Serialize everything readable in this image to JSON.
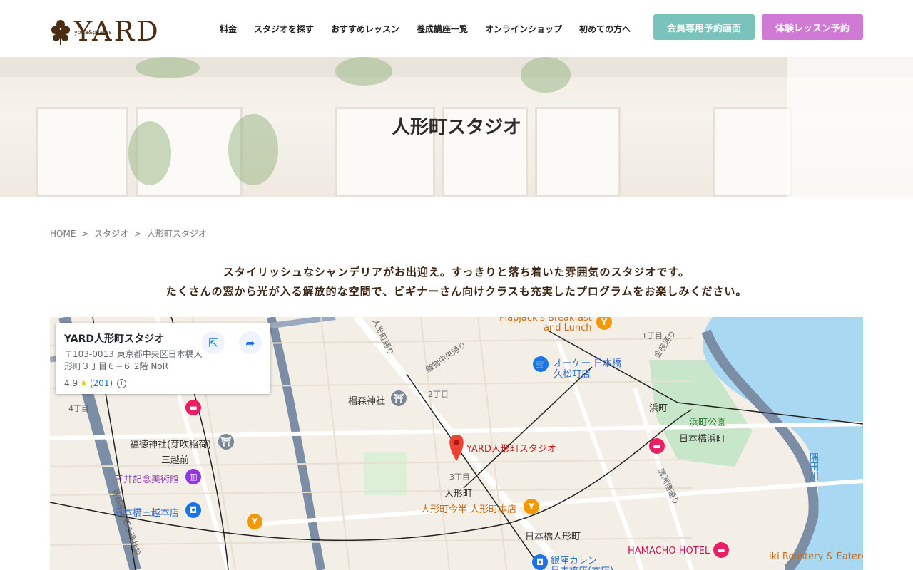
{
  "header": {
    "logo_text": "YARD",
    "logo_sub": "yoga&pilates",
    "nav": [
      "料金",
      "スタジオを探す",
      "おすすめレッスン",
      "養成講座一覧",
      "オンラインショップ",
      "初めての方へ"
    ],
    "member_button": "会員専用予約画面",
    "trial_button": "体験レッスン予約",
    "colors": {
      "member": "#79c3bc",
      "trial": "#d079d5",
      "logo": "#4b2d14"
    }
  },
  "hero": {
    "title": "人形町スタジオ"
  },
  "breadcrumb": {
    "home": "HOME",
    "sep1": ">",
    "studio": "スタジオ",
    "sep2": ">",
    "current": "人形町スタジオ"
  },
  "intro": {
    "line1": "スタイリッシュなシャンデリアがお出迎え。すっきりと落ち着いた雰囲気のスタジオです。",
    "line2": "たくさんの窓から光が入る解放的な空間で、ビギナーさん向けクラスも充実したプログラムをお楽しみください。"
  },
  "map": {
    "card": {
      "name": "YARD人形町スタジオ",
      "address": "〒103-0013 東京都中央区日本橋人形町３丁目６−６ 2階 NoR",
      "rating": "4.9",
      "reviews": "201",
      "open_icon": "open-in-new-icon",
      "directions_icon": "directions-icon"
    },
    "labels": {
      "marker": "YARD人形町スタジオ",
      "ningyocho": "人形町",
      "hamacho": "浜町",
      "hamacho_park": "浜町公園",
      "nihonbashi_hamacho": "日本橋浜町",
      "nihonbashi_ningyocho": "日本橋人形町",
      "okay": "オーケー 日本橋",
      "okay2": "久松町店",
      "flapjack": "Flapjack's Breakfast",
      "flapjack2": "and Lunch",
      "sugimori": "椙森神社",
      "fukutoku": "福徳神社(芽吹稲荷)",
      "mitsukoshimae": "三越前",
      "mitsui": "三井記念美術館",
      "mitsukoshi": "日本橋三越本店",
      "imahan": "人形町今半 人形町本店",
      "hamacho_hotel": "HAMACHO HOTEL",
      "ginza_curry": "銀座カレン",
      "ginza_curry2": "日本橋店(本店)",
      "sumida": "隅田川",
      "roastery": "iki Roastery & Eatery",
      "kinza": "金座通り",
      "orimono": "織物中央通り",
      "ningyo_dori": "人形町通り",
      "kiyosu": "清洲橋通り",
      "shuto": "首都高速都心環状線",
      "c3_1": "1丁目",
      "c3_2": "2丁目",
      "c3_3": "3丁目",
      "c3_4": "4丁目"
    }
  }
}
